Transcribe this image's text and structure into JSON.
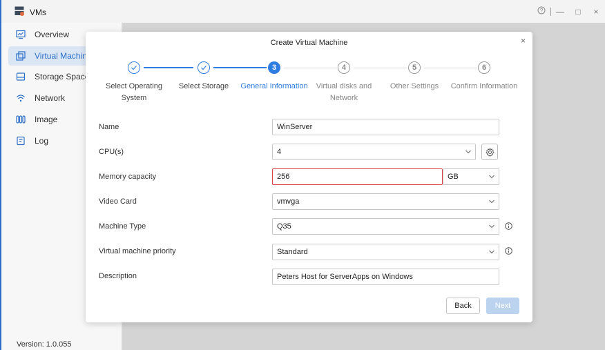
{
  "app": {
    "title": "VMs"
  },
  "window_controls": {
    "help": "?",
    "minimize": "—",
    "maximize": "□",
    "close": "×"
  },
  "sidebar": {
    "items": [
      {
        "label": "Overview",
        "icon": "chart-monitor-icon",
        "active": false
      },
      {
        "label": "Virtual Machine",
        "icon": "windows-icon",
        "active": true
      },
      {
        "label": "Storage Space",
        "icon": "storage-icon",
        "active": false
      },
      {
        "label": "Network",
        "icon": "wifi-icon",
        "active": false
      },
      {
        "label": "Image",
        "icon": "disc-icon",
        "active": false
      },
      {
        "label": "Log",
        "icon": "log-icon",
        "active": false
      }
    ],
    "version": "Version: 1.0.055"
  },
  "modal": {
    "title": "Create Virtual Machine",
    "close": "×",
    "steps": [
      {
        "number": "1",
        "label": "Select Operating System",
        "state": "done"
      },
      {
        "number": "2",
        "label": "Select Storage",
        "state": "done"
      },
      {
        "number": "3",
        "label": "General Information",
        "state": "current"
      },
      {
        "number": "4",
        "label": "Virtual disks and Network",
        "state": "todo"
      },
      {
        "number": "5",
        "label": "Other Settings",
        "state": "todo"
      },
      {
        "number": "6",
        "label": "Confirm Information",
        "state": "todo"
      }
    ],
    "form": {
      "name": {
        "label": "Name",
        "value": "WinServer"
      },
      "cpu": {
        "label": "CPU(s)",
        "value": "4"
      },
      "memory": {
        "label": "Memory capacity",
        "value": "256",
        "unit": "GB"
      },
      "video_card": {
        "label": "Video Card",
        "value": "vmvga"
      },
      "machine_type": {
        "label": "Machine Type",
        "value": "Q35"
      },
      "priority": {
        "label": "Virtual machine priority",
        "value": "Standard"
      },
      "description": {
        "label": "Description",
        "value": "Peters Host for ServerApps on Windows"
      }
    },
    "buttons": {
      "back": "Back",
      "next": "Next"
    }
  },
  "colors": {
    "accent": "#2f7de1",
    "error": "#d9434a",
    "active_nav_bg": "#dbe6f5"
  }
}
